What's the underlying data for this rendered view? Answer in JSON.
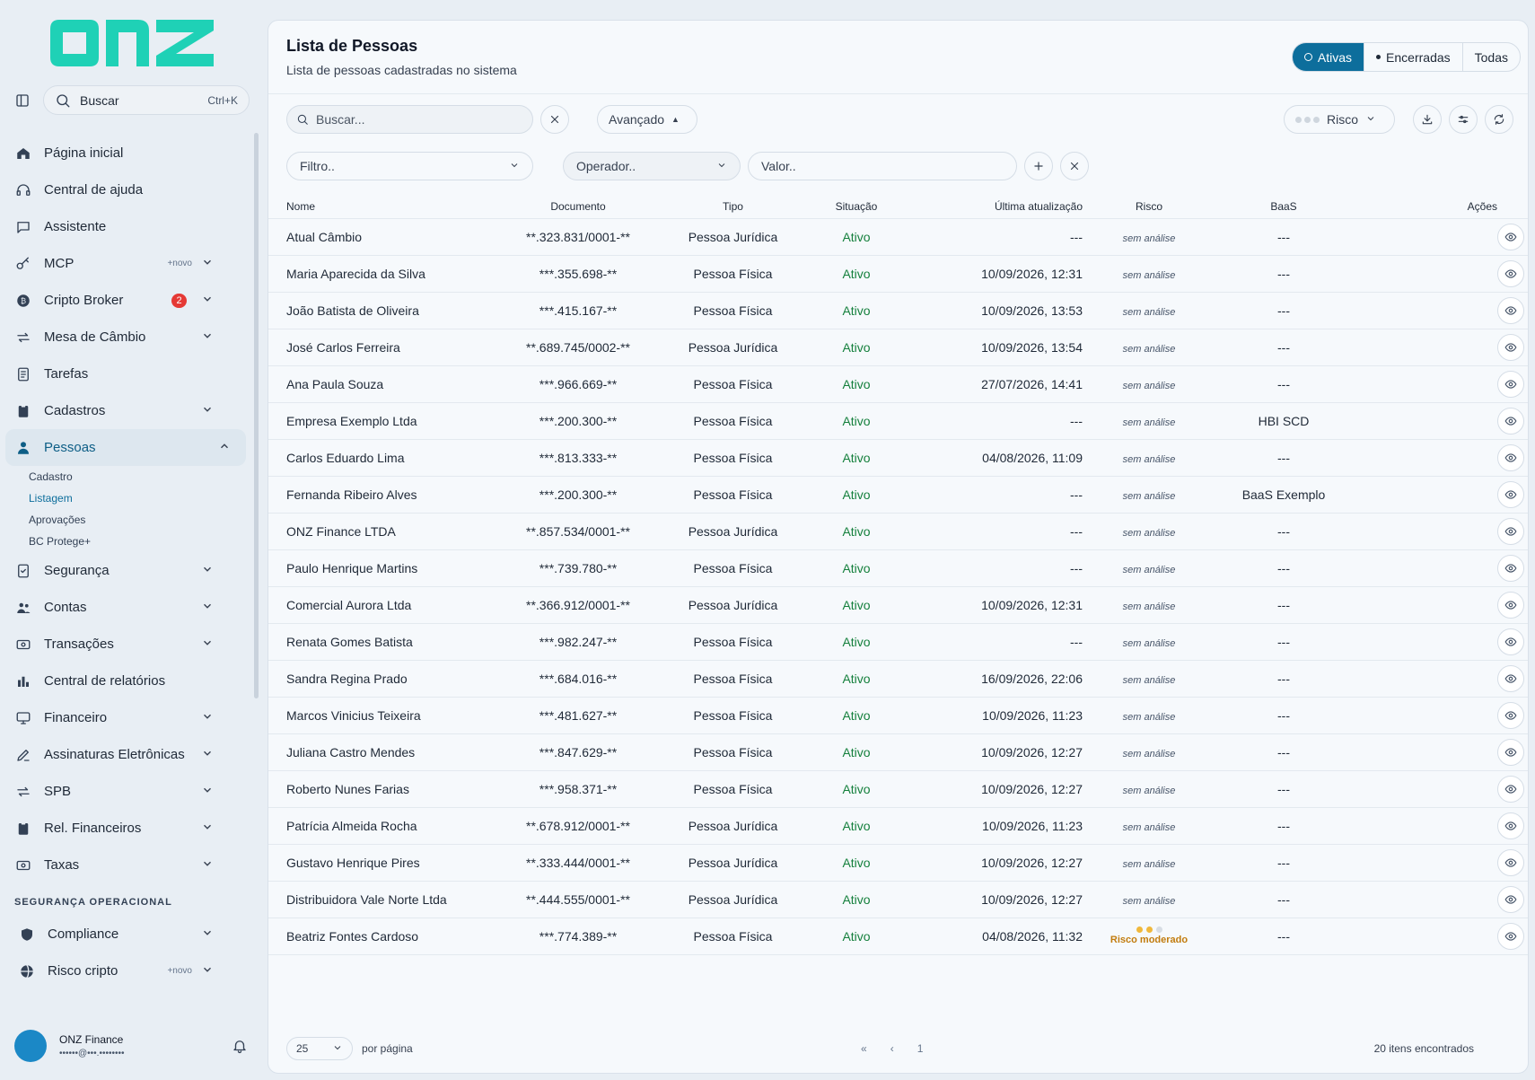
{
  "brand": {
    "logo_text": "onz",
    "color": "#1fd1b6"
  },
  "sidebar": {
    "search": {
      "label": "Buscar",
      "shortcut": "Ctrl+K"
    },
    "items": [
      {
        "label": "Página inicial",
        "icon": "home-icon"
      },
      {
        "label": "Central de ajuda",
        "icon": "headset-icon"
      },
      {
        "label": "Assistente",
        "icon": "chat-icon"
      },
      {
        "label": "MCP",
        "icon": "key-icon",
        "tag": "+novo",
        "expandable": true
      },
      {
        "label": "Cripto Broker",
        "icon": "bitcoin-icon",
        "badge": "2",
        "expandable": true
      },
      {
        "label": "Mesa de Câmbio",
        "icon": "exchange-icon",
        "expandable": true
      },
      {
        "label": "Tarefas",
        "icon": "tasks-icon"
      },
      {
        "label": "Cadastros",
        "icon": "clipboard-icon",
        "expandable": true
      },
      {
        "label": "Pessoas",
        "icon": "person-icon",
        "expandable": true,
        "active": true
      },
      {
        "label": "Segurança",
        "icon": "shield-check-icon",
        "expandable": true
      },
      {
        "label": "Contas",
        "icon": "users-icon",
        "expandable": true
      },
      {
        "label": "Transações",
        "icon": "money-icon",
        "expandable": true
      },
      {
        "label": "Central de relatórios",
        "icon": "report-icon"
      },
      {
        "label": "Financeiro",
        "icon": "monitor-icon",
        "expandable": true
      },
      {
        "label": "Assinaturas Eletrônicas",
        "icon": "signature-icon",
        "expandable": true
      },
      {
        "label": "SPB",
        "icon": "exchange-icon",
        "expandable": true
      },
      {
        "label": "Rel. Financeiros",
        "icon": "clipboard-icon",
        "expandable": true
      },
      {
        "label": "Taxas",
        "icon": "money-icon",
        "expandable": true
      }
    ],
    "subitems": [
      "Cadastro",
      "Listagem",
      "Aprovações",
      "BC Protege+"
    ],
    "section_title": "SEGURANÇA OPERACIONAL",
    "section_items": [
      {
        "label": "Compliance",
        "icon": "shield-icon",
        "expandable": true
      },
      {
        "label": "Risco cripto",
        "icon": "globe-icon",
        "tag": "+novo",
        "expandable": true
      }
    ],
    "user": {
      "name": "ONZ Finance",
      "email": "••••••@•••.••••••••"
    }
  },
  "page": {
    "title": "Lista de Pessoas",
    "subtitle": "Lista de pessoas cadastradas no sistema",
    "filters": {
      "active": "Ativas",
      "closed": "Encerradas",
      "all": "Todas"
    },
    "search_placeholder": "Buscar...",
    "advanced_label": "Avançado",
    "risk_label": "Risco",
    "filter_placeholder": "Filtro..",
    "operator_placeholder": "Operador..",
    "value_placeholder": "Valor.."
  },
  "table": {
    "headers": [
      "Nome",
      "Documento",
      "Tipo",
      "Situação",
      "Última atualização",
      "Risco",
      "BaaS",
      "Ações"
    ],
    "rows": [
      {
        "nome": "Atual Câmbio",
        "doc": "**.323.831/0001-**",
        "tipo": "Pessoa Jurídica",
        "sit": "Ativo",
        "upd": "---",
        "risco": "sem análise",
        "baas": "---"
      },
      {
        "nome": "Maria Aparecida da Silva",
        "doc": "***.355.698-**",
        "tipo": "Pessoa Física",
        "sit": "Ativo",
        "upd": "10/09/2026, 12:31",
        "risco": "sem análise",
        "baas": "---"
      },
      {
        "nome": "João Batista de Oliveira",
        "doc": "***.415.167-**",
        "tipo": "Pessoa Física",
        "sit": "Ativo",
        "upd": "10/09/2026, 13:53",
        "risco": "sem análise",
        "baas": "---"
      },
      {
        "nome": "José Carlos Ferreira",
        "doc": "**.689.745/0002-**",
        "tipo": "Pessoa Jurídica",
        "sit": "Ativo",
        "upd": "10/09/2026, 13:54",
        "risco": "sem análise",
        "baas": "---"
      },
      {
        "nome": "Ana Paula Souza",
        "doc": "***.966.669-**",
        "tipo": "Pessoa Física",
        "sit": "Ativo",
        "upd": "27/07/2026, 14:41",
        "risco": "sem análise",
        "baas": "---"
      },
      {
        "nome": "Empresa Exemplo Ltda",
        "doc": "***.200.300-**",
        "tipo": "Pessoa Física",
        "sit": "Ativo",
        "upd": "---",
        "risco": "sem análise",
        "baas": "HBI SCD"
      },
      {
        "nome": "Carlos Eduardo Lima",
        "doc": "***.813.333-**",
        "tipo": "Pessoa Física",
        "sit": "Ativo",
        "upd": "04/08/2026, 11:09",
        "risco": "sem análise",
        "baas": "---"
      },
      {
        "nome": "Fernanda Ribeiro Alves",
        "doc": "***.200.300-**",
        "tipo": "Pessoa Física",
        "sit": "Ativo",
        "upd": "---",
        "risco": "sem análise",
        "baas": "BaaS Exemplo"
      },
      {
        "nome": "ONZ Finance LTDA",
        "doc": "**.857.534/0001-**",
        "tipo": "Pessoa Jurídica",
        "sit": "Ativo",
        "upd": "---",
        "risco": "sem análise",
        "baas": "---"
      },
      {
        "nome": "Paulo Henrique Martins",
        "doc": "***.739.780-**",
        "tipo": "Pessoa Física",
        "sit": "Ativo",
        "upd": "---",
        "risco": "sem análise",
        "baas": "---"
      },
      {
        "nome": "Comercial Aurora Ltda",
        "doc": "**.366.912/0001-**",
        "tipo": "Pessoa Jurídica",
        "sit": "Ativo",
        "upd": "10/09/2026, 12:31",
        "risco": "sem análise",
        "baas": "---"
      },
      {
        "nome": "Renata Gomes Batista",
        "doc": "***.982.247-**",
        "tipo": "Pessoa Física",
        "sit": "Ativo",
        "upd": "---",
        "risco": "sem análise",
        "baas": "---"
      },
      {
        "nome": "Sandra Regina Prado",
        "doc": "***.684.016-**",
        "tipo": "Pessoa Física",
        "sit": "Ativo",
        "upd": "16/09/2026, 22:06",
        "risco": "sem análise",
        "baas": "---"
      },
      {
        "nome": "Marcos Vinicius Teixeira",
        "doc": "***.481.627-**",
        "tipo": "Pessoa Física",
        "sit": "Ativo",
        "upd": "10/09/2026, 11:23",
        "risco": "sem análise",
        "baas": "---"
      },
      {
        "nome": "Juliana Castro Mendes",
        "doc": "***.847.629-**",
        "tipo": "Pessoa Física",
        "sit": "Ativo",
        "upd": "10/09/2026, 12:27",
        "risco": "sem análise",
        "baas": "---"
      },
      {
        "nome": "Roberto Nunes Farias",
        "doc": "***.958.371-**",
        "tipo": "Pessoa Física",
        "sit": "Ativo",
        "upd": "10/09/2026, 12:27",
        "risco": "sem análise",
        "baas": "---"
      },
      {
        "nome": "Patrícia Almeida Rocha",
        "doc": "**.678.912/0001-**",
        "tipo": "Pessoa Jurídica",
        "sit": "Ativo",
        "upd": "10/09/2026, 11:23",
        "risco": "sem análise",
        "baas": "---"
      },
      {
        "nome": "Gustavo Henrique Pires",
        "doc": "**.333.444/0001-**",
        "tipo": "Pessoa Jurídica",
        "sit": "Ativo",
        "upd": "10/09/2026, 12:27",
        "risco": "sem análise",
        "baas": "---"
      },
      {
        "nome": "Distribuidora Vale Norte Ltda",
        "doc": "**.444.555/0001-**",
        "tipo": "Pessoa Jurídica",
        "sit": "Ativo",
        "upd": "10/09/2026, 12:27",
        "risco": "sem análise",
        "baas": "---"
      },
      {
        "nome": "Beatriz Fontes Cardoso",
        "doc": "***.774.389-**",
        "tipo": "Pessoa Física",
        "sit": "Ativo",
        "upd": "04/08/2026, 11:32",
        "risco": "Risco moderado",
        "risk_level": 2,
        "baas": "---"
      }
    ]
  },
  "footer": {
    "per_page": "25",
    "per_page_label": "por página",
    "page": "1",
    "count": "20 itens encontrados"
  },
  "colors": {
    "accent": "#0d6e9c",
    "status_active": "#15803d",
    "risk_moderate": "#c27c0e",
    "badge": "#e53935"
  }
}
